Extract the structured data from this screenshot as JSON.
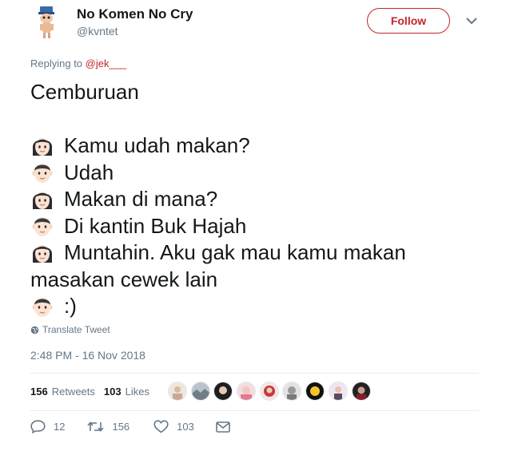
{
  "author": {
    "name": "No Komen No Cry",
    "handle": "@kvntet"
  },
  "follow_label": "Follow",
  "replying": {
    "prefix": "Replying to ",
    "mention": "@jek___"
  },
  "tweet": {
    "title_line": "Cemburuan",
    "lines": [
      {
        "icon": "woman-emoji-icon",
        "text": "Kamu udah makan?"
      },
      {
        "icon": "man-emoji-icon",
        "text": "Udah"
      },
      {
        "icon": "woman-emoji-icon",
        "text": "Makan di mana?"
      },
      {
        "icon": "man-emoji-icon",
        "text": "Di kantin Buk Hajah"
      },
      {
        "icon": "woman-emoji-icon",
        "text": "Muntahin. Aku gak mau kamu makan"
      },
      {
        "icon": "",
        "text": "masakan cewek lain"
      },
      {
        "icon": "man-emoji-icon",
        "text": ":)"
      }
    ]
  },
  "translate_label": "Translate Tweet",
  "timestamp": "2:48 PM - 16 Nov 2018",
  "stats": {
    "retweets_count": "156",
    "retweets_label": "Retweets",
    "likes_count": "103",
    "likes_label": "Likes"
  },
  "actions": {
    "replies": "12",
    "retweets": "156",
    "likes": "103"
  },
  "colors": {
    "accent": "#c2262a",
    "muted": "#657786",
    "text": "#14171a"
  }
}
